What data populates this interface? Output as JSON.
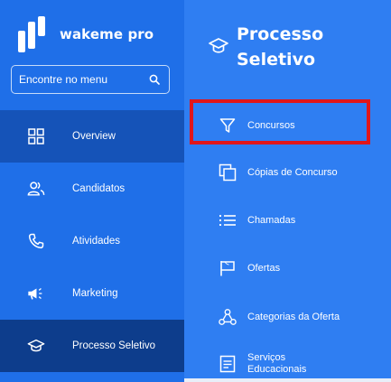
{
  "brand": {
    "name": "wakeme pro",
    "logo_icon": "wakeme-logo"
  },
  "search": {
    "placeholder": "Encontre no menu",
    "value": "",
    "icon": "search-icon"
  },
  "colors": {
    "sidebar_bg": "#1f6fe8",
    "panel_bg": "#2f7ef2",
    "overview_bg": "#1553b8",
    "selected_bg": "#0d3d8c",
    "highlight_border": "#e0161b"
  },
  "sidebar": {
    "items": [
      {
        "label": "Overview",
        "icon": "grid-icon"
      },
      {
        "label": "Candidatos",
        "icon": "users-icon"
      },
      {
        "label": "Atividades",
        "icon": "phone-icon"
      },
      {
        "label": "Marketing",
        "icon": "megaphone-icon"
      },
      {
        "label": "Processo Seletivo",
        "icon": "graduation-cap-icon",
        "selected": true
      }
    ]
  },
  "panel": {
    "title": "Processo Seletivo",
    "icon": "graduation-cap-icon",
    "items": [
      {
        "label": "Concursos",
        "icon": "filter-icon",
        "highlighted": true
      },
      {
        "label": "Cópias de Concurso",
        "icon": "copy-icon"
      },
      {
        "label": "Chamadas",
        "icon": "list-icon"
      },
      {
        "label": "Ofertas",
        "icon": "flag-icon"
      },
      {
        "label": "Categorias da Oferta",
        "icon": "hierarchy-icon"
      },
      {
        "label": "Serviços Educacionais",
        "icon": "document-icon"
      }
    ]
  }
}
